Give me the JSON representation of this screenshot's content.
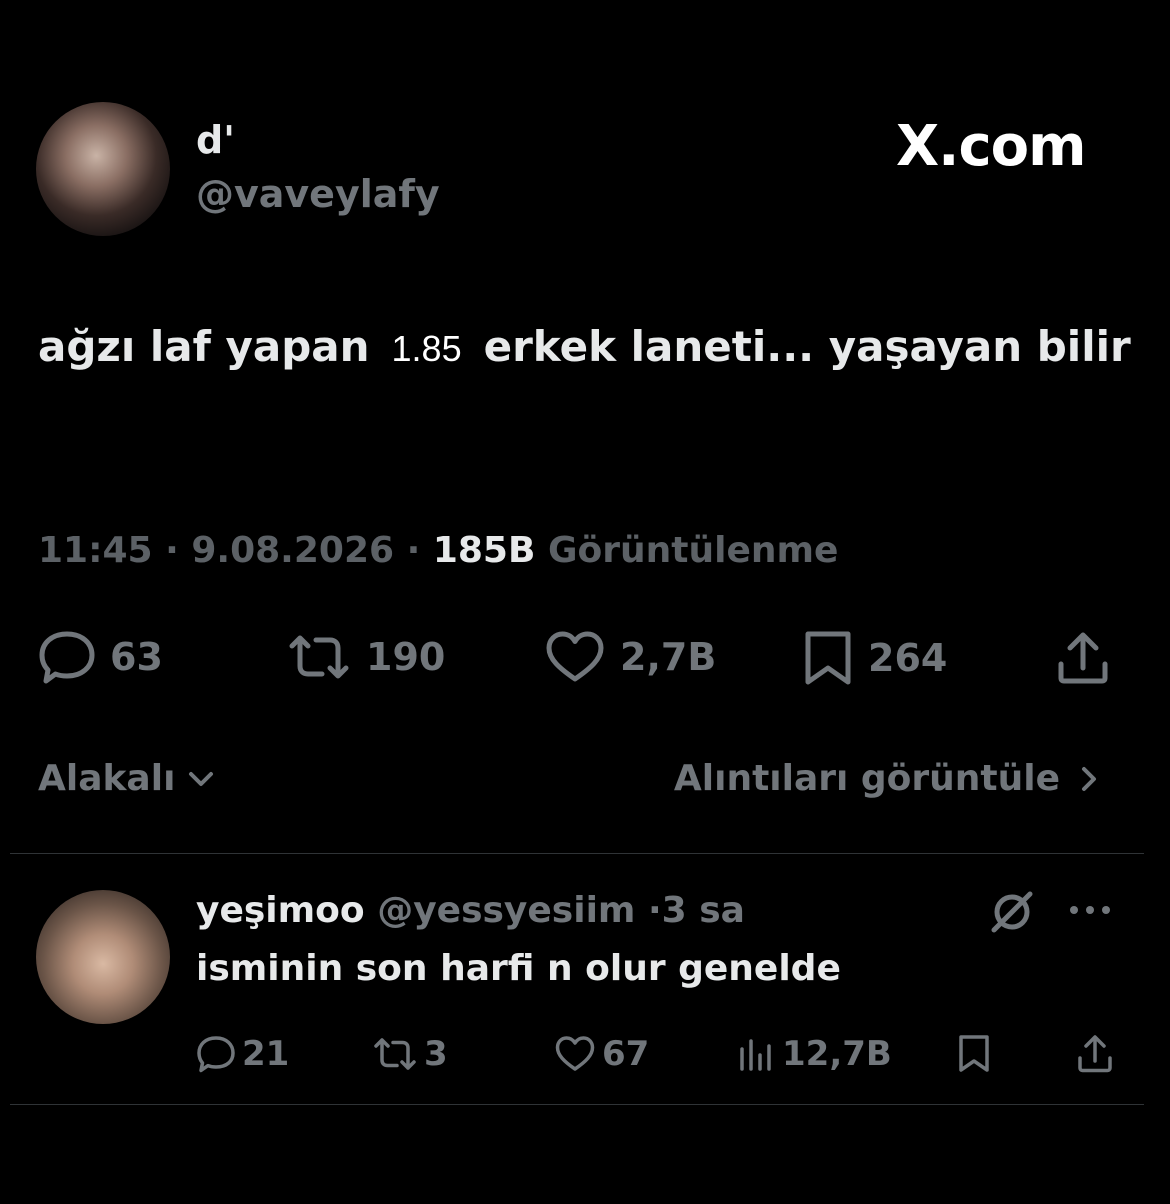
{
  "brand": {
    "text": "X.com"
  },
  "tweet": {
    "author": {
      "name": "d'",
      "handle": "@vaveylafy"
    },
    "text_part1": "ağzı laf yapan",
    "inline_number": "1.85",
    "text_part2": "erkek laneti... yaşayan bilir",
    "time": "11:45",
    "date": "9.08.2026",
    "views_count": "185B",
    "views_label": "Görüntülenme",
    "actions": {
      "replies": "63",
      "retweets": "190",
      "likes": "2,7B",
      "bookmarks": "264"
    }
  },
  "sort": {
    "label": "Alakalı"
  },
  "quotes": {
    "label": "Alıntıları görüntüle"
  },
  "reply": {
    "name": "yeşimoo",
    "handle": "@yessyesiim",
    "time": "3 sa",
    "text": "isminin son harfi n olur genelde",
    "actions": {
      "replies": "21",
      "retweets": "3",
      "likes": "67",
      "views": "12,7B"
    }
  },
  "icons": {
    "reply": "speech-bubble-icon",
    "retweet": "retweet-icon",
    "like": "heart-icon",
    "bookmark": "bookmark-icon",
    "share": "share-icon",
    "views": "bar-chart-icon",
    "grok": "grok-icon",
    "more": "more-dots-icon"
  },
  "colors": {
    "background": "#000000",
    "text": "#e7e9ea",
    "muted": "#71767b",
    "divider": "#2f3336"
  }
}
